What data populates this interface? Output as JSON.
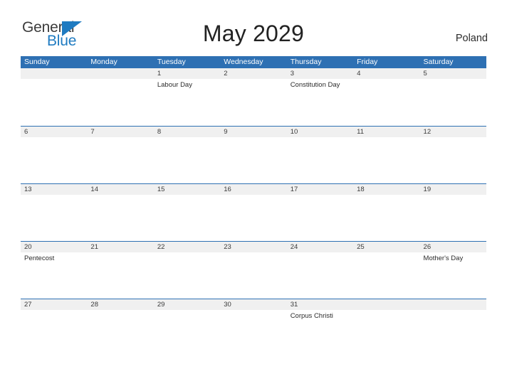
{
  "brand": {
    "word_one": "General",
    "word_two": "Blue",
    "flag_icon": "blue-triangle-flag",
    "color_primary": "#1f7bc1",
    "color_text": "#3c3c3c"
  },
  "header": {
    "title": "May 2029",
    "country": "Poland"
  },
  "calendar": {
    "header_color": "#2e70b3",
    "day_band_color": "#f0f0f0",
    "weekdays": [
      "Sunday",
      "Monday",
      "Tuesday",
      "Wednesday",
      "Thursday",
      "Friday",
      "Saturday"
    ],
    "weeks": [
      {
        "days": [
          {
            "num": "",
            "event": ""
          },
          {
            "num": "",
            "event": ""
          },
          {
            "num": "1",
            "event": "Labour Day"
          },
          {
            "num": "2",
            "event": ""
          },
          {
            "num": "3",
            "event": "Constitution Day"
          },
          {
            "num": "4",
            "event": ""
          },
          {
            "num": "5",
            "event": ""
          }
        ]
      },
      {
        "days": [
          {
            "num": "6",
            "event": ""
          },
          {
            "num": "7",
            "event": ""
          },
          {
            "num": "8",
            "event": ""
          },
          {
            "num": "9",
            "event": ""
          },
          {
            "num": "10",
            "event": ""
          },
          {
            "num": "11",
            "event": ""
          },
          {
            "num": "12",
            "event": ""
          }
        ]
      },
      {
        "days": [
          {
            "num": "13",
            "event": ""
          },
          {
            "num": "14",
            "event": ""
          },
          {
            "num": "15",
            "event": ""
          },
          {
            "num": "16",
            "event": ""
          },
          {
            "num": "17",
            "event": ""
          },
          {
            "num": "18",
            "event": ""
          },
          {
            "num": "19",
            "event": ""
          }
        ]
      },
      {
        "days": [
          {
            "num": "20",
            "event": "Pentecost"
          },
          {
            "num": "21",
            "event": ""
          },
          {
            "num": "22",
            "event": ""
          },
          {
            "num": "23",
            "event": ""
          },
          {
            "num": "24",
            "event": ""
          },
          {
            "num": "25",
            "event": ""
          },
          {
            "num": "26",
            "event": "Mother's Day"
          }
        ]
      },
      {
        "days": [
          {
            "num": "27",
            "event": ""
          },
          {
            "num": "28",
            "event": ""
          },
          {
            "num": "29",
            "event": ""
          },
          {
            "num": "30",
            "event": ""
          },
          {
            "num": "31",
            "event": "Corpus Christi"
          },
          {
            "num": "",
            "event": ""
          },
          {
            "num": "",
            "event": ""
          }
        ]
      }
    ]
  }
}
